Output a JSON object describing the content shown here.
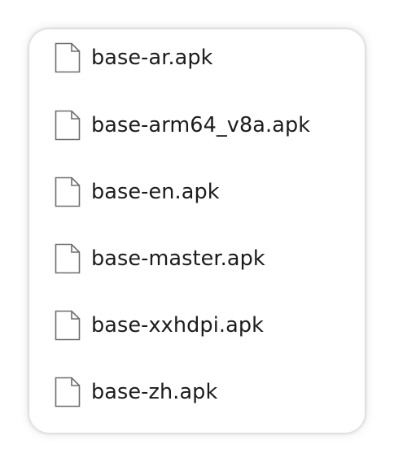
{
  "files": [
    {
      "name": "base-ar.apk",
      "icon": "file-icon"
    },
    {
      "name": "base-arm64_v8a.apk",
      "icon": "file-icon"
    },
    {
      "name": "base-en.apk",
      "icon": "file-icon"
    },
    {
      "name": "base-master.apk",
      "icon": "file-icon"
    },
    {
      "name": "base-xxhdpi.apk",
      "icon": "file-icon"
    },
    {
      "name": "base-zh.apk",
      "icon": "file-icon"
    }
  ],
  "colors": {
    "text": "#1c1c1c",
    "icon_stroke": "#6e6e6e",
    "background": "#ffffff"
  }
}
